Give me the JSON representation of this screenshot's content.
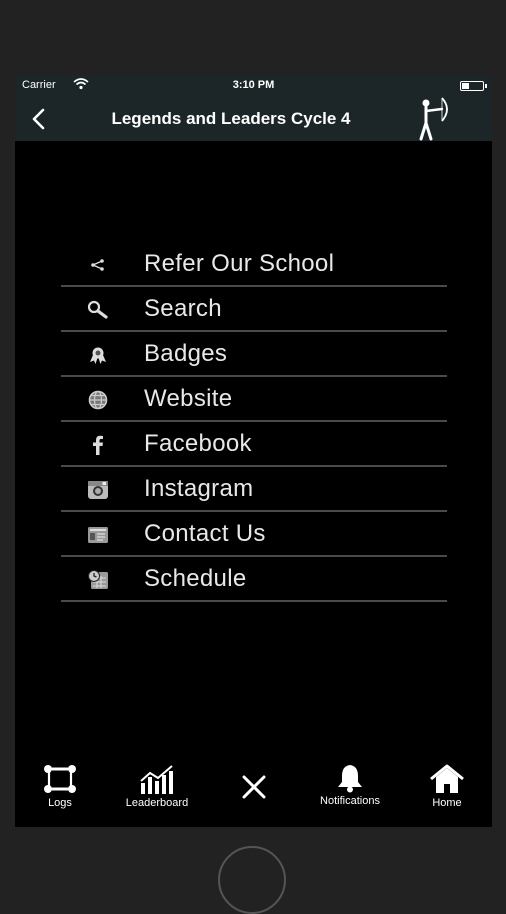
{
  "status": {
    "carrier": "Carrier",
    "time": "3:10 PM"
  },
  "nav": {
    "title": "Legends and Leaders Cycle 4"
  },
  "menu": {
    "items": [
      {
        "label": "Refer Our School",
        "icon": "share-icon"
      },
      {
        "label": "Search",
        "icon": "search-icon"
      },
      {
        "label": "Badges",
        "icon": "badge-icon"
      },
      {
        "label": "Website",
        "icon": "globe-icon"
      },
      {
        "label": "Facebook",
        "icon": "facebook-icon"
      },
      {
        "label": "Instagram",
        "icon": "instagram-icon"
      },
      {
        "label": "Contact Us",
        "icon": "contact-card-icon"
      },
      {
        "label": "Schedule",
        "icon": "calendar-clock-icon"
      }
    ]
  },
  "tabs": [
    {
      "label": "Logs",
      "icon": "scroll-icon"
    },
    {
      "label": "Leaderboard",
      "icon": "bar-chart-icon"
    },
    {
      "label": "",
      "icon": "close-icon"
    },
    {
      "label": "Notifications",
      "icon": "bell-icon"
    },
    {
      "label": "Home",
      "icon": "home-icon"
    }
  ],
  "colors": {
    "bar_bg": "#1c2628",
    "screen_bg": "#000000",
    "divider": "#4a4a4a"
  }
}
